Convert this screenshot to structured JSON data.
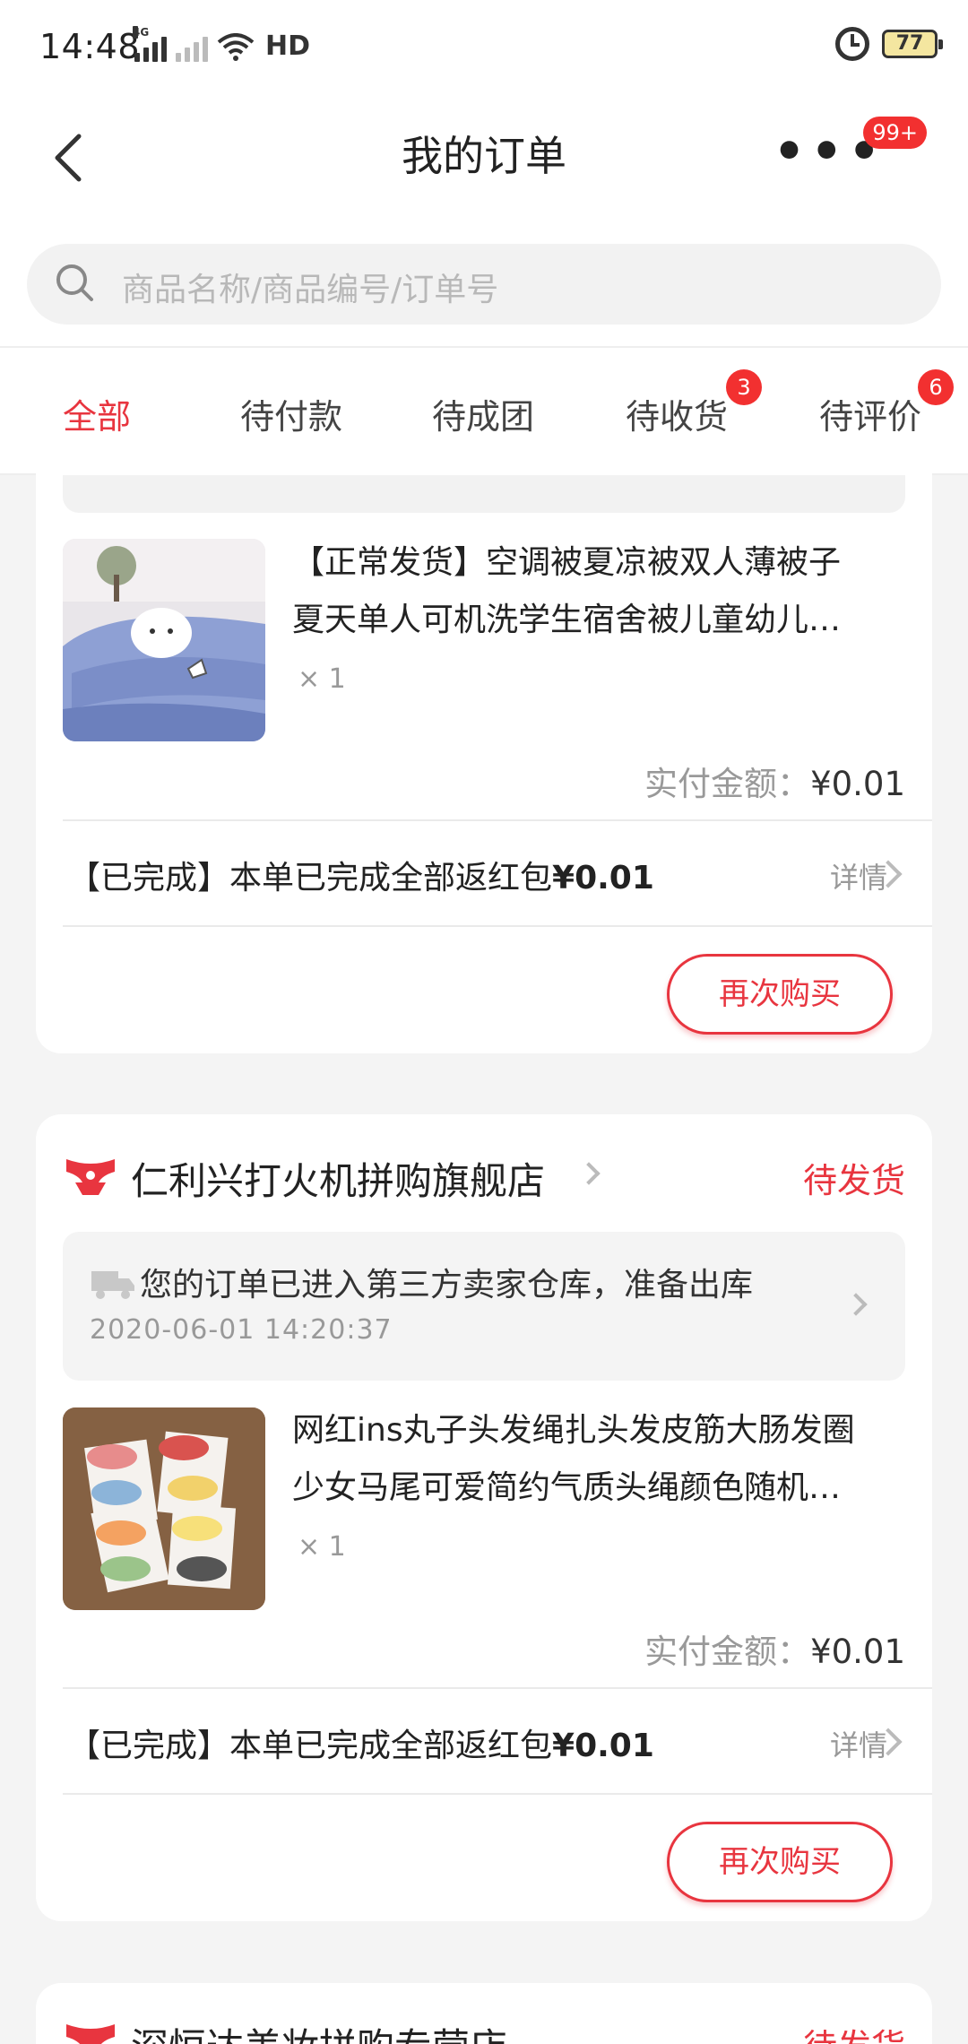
{
  "status_bar": {
    "time": "14:48",
    "network": "4G",
    "wifi_label": "HD",
    "battery": "77"
  },
  "header": {
    "title": "我的订单",
    "more_badge": "99+"
  },
  "search": {
    "placeholder": "商品名称/商品编号/订单号"
  },
  "tabs": [
    {
      "label": "全部",
      "active": true,
      "badge": ""
    },
    {
      "label": "待付款",
      "active": false,
      "badge": ""
    },
    {
      "label": "待成团",
      "active": false,
      "badge": ""
    },
    {
      "label": "待收货",
      "active": false,
      "badge": "3"
    },
    {
      "label": "待评价",
      "active": false,
      "badge": "6"
    }
  ],
  "orders": [
    {
      "product_line1": "【正常发货】空调被夏凉被双人薄被子",
      "product_line2": "夏天单人可机洗学生宿舍被儿童幼儿…",
      "qty": "× 1",
      "paid_label": "实付金额：",
      "paid_amount": "¥0.01",
      "rebate_prefix": "【已完成】本单已完成全部返红包",
      "rebate_amount": "¥0.01",
      "detail_label": "详情",
      "rebuy_label": "再次购买"
    },
    {
      "store_name": "仁利兴打火机拼购旗舰店",
      "status": "待发货",
      "ship_message": "您的订单已进入第三方卖家仓库，准备出库",
      "ship_time": "2020-06-01 14:20:37",
      "product_line1": "网红ins丸子头发绳扎头发皮筋大肠发圈",
      "product_line2": "少女马尾可爱简约气质头绳颜色随机…",
      "qty": "× 1",
      "paid_label": "实付金额：",
      "paid_amount": "¥0.01",
      "rebate_prefix": "【已完成】本单已完成全部返红包",
      "rebate_amount": "¥0.01",
      "detail_label": "详情",
      "rebuy_label": "再次购买"
    },
    {
      "store_name": "深恒达美妆拼购专营店",
      "status": "待发货"
    }
  ],
  "colors": {
    "accent": "#e8353f",
    "background": "#f4f4f4"
  }
}
